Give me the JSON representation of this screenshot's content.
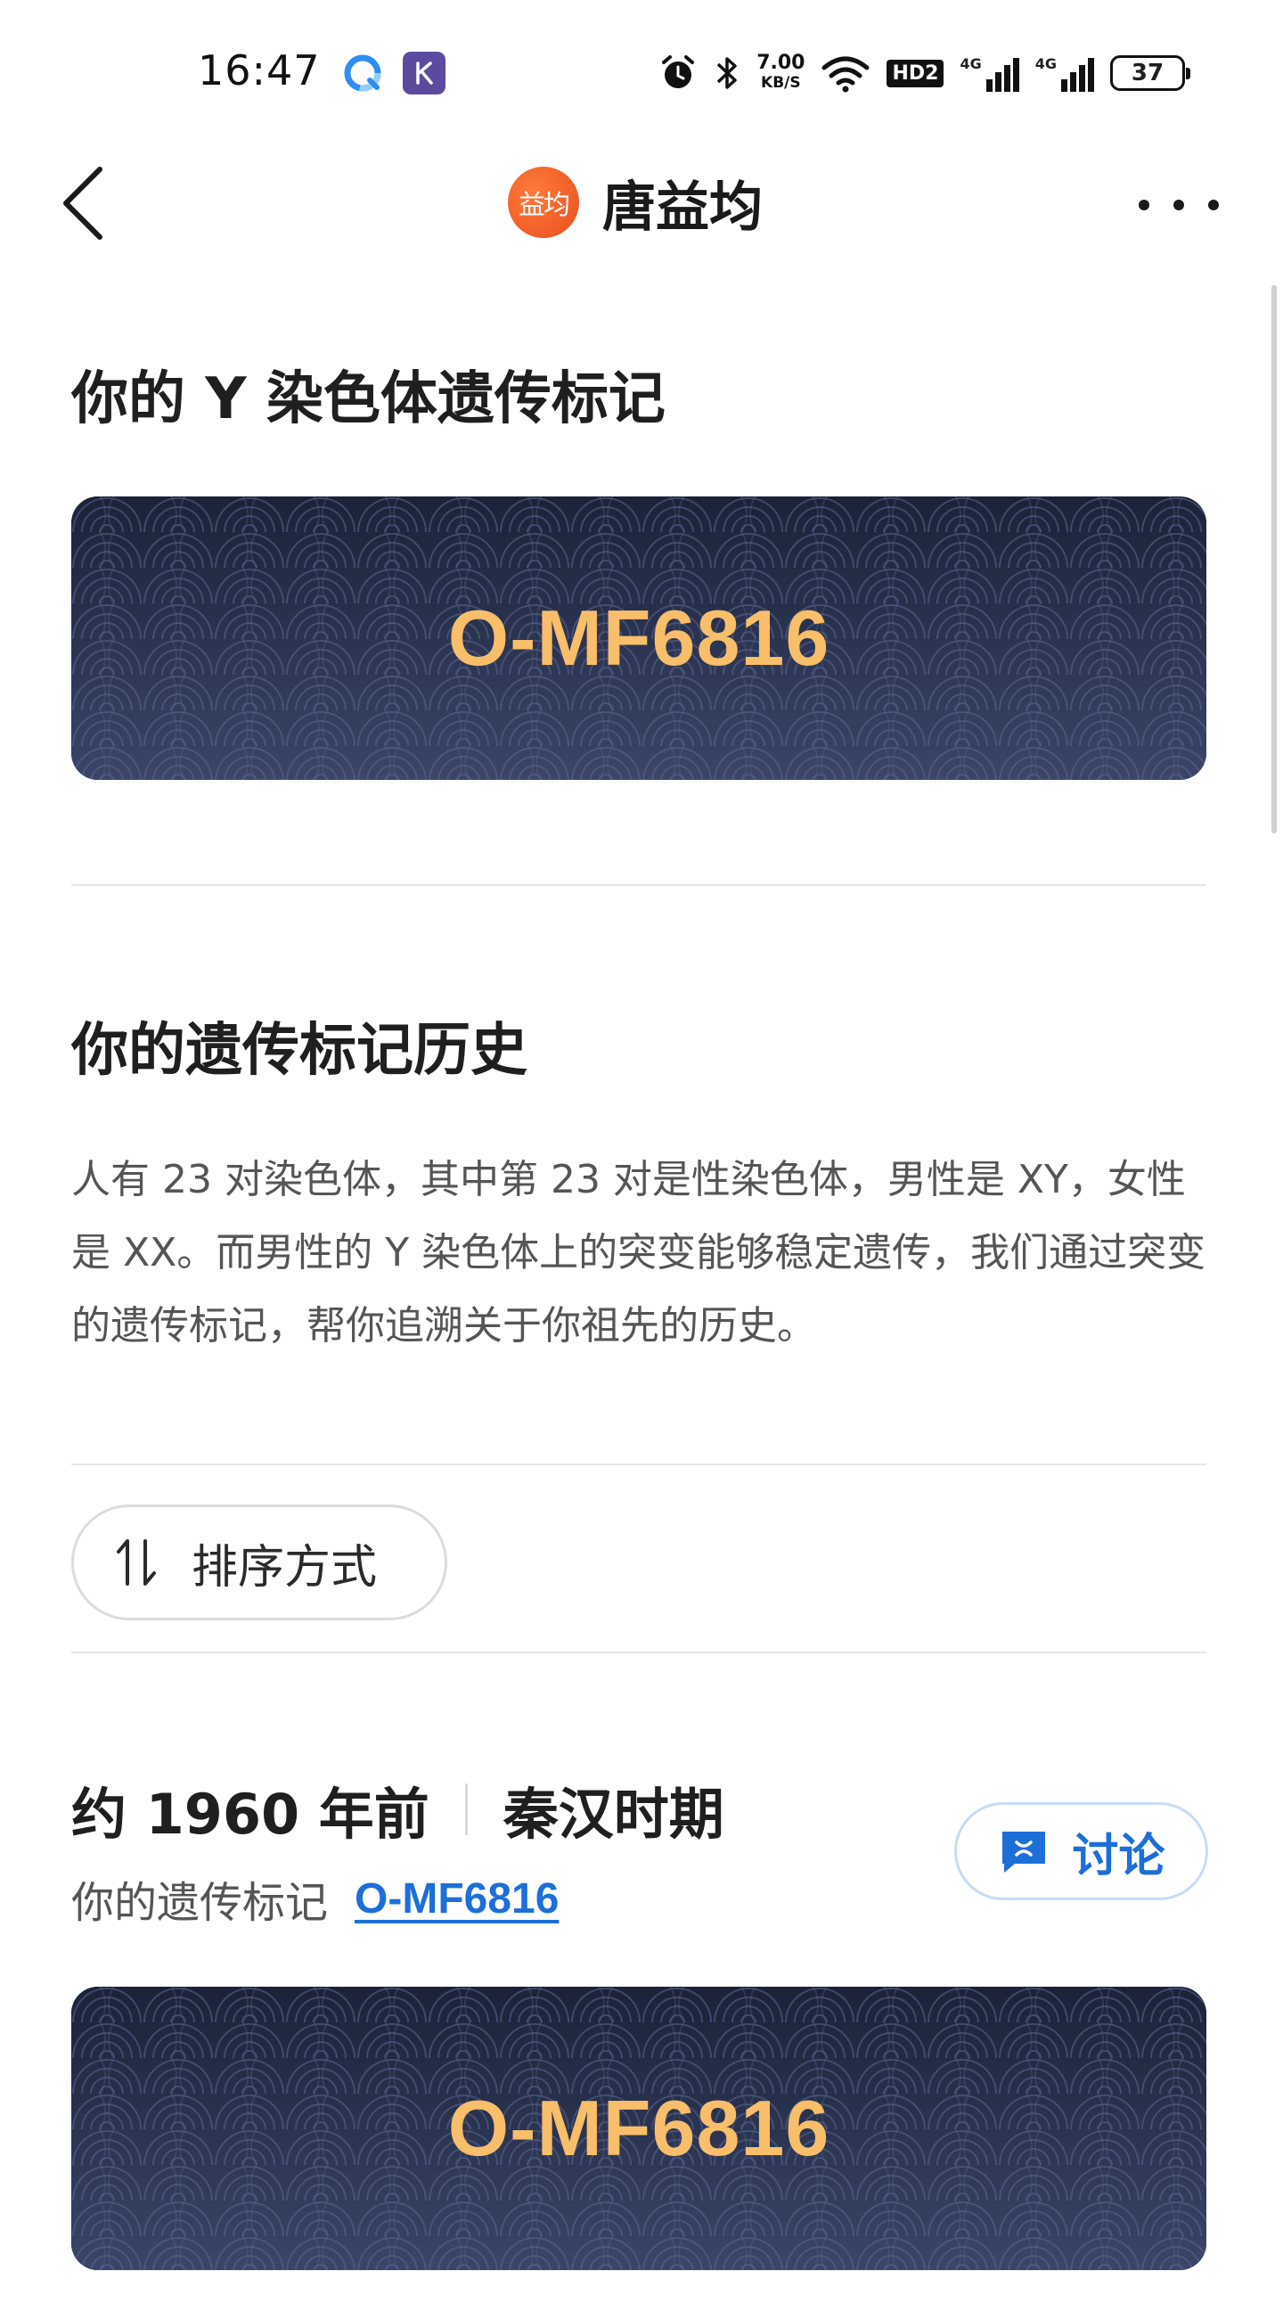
{
  "status_bar": {
    "time": "16:47",
    "net_speed_value": "7.00",
    "net_speed_unit": "KB/S",
    "hd_label": "HD2",
    "sim1_label": "4G",
    "sim2_label": "4G",
    "battery": "37"
  },
  "nav": {
    "avatar_text": "益均",
    "title": "唐益均"
  },
  "y_marker_section": {
    "heading": "你的 Y 染色体遗传标记",
    "marker_code": "O-MF6816"
  },
  "history_section": {
    "heading": "你的遗传标记历史",
    "description": "人有 23 对染色体，其中第 23 对是性染色体，男性是 XY，女性是 XX。而男性的 Y 染色体上的突变能够稳定遗传，我们通过突变的遗传标记，帮你追溯关于你祖先的历史。",
    "sort_label": "排序方式"
  },
  "era_entry": {
    "time_ago": "约 1960 年前",
    "period": "秦汉时期",
    "marker_prefix": "你的遗传标记",
    "marker_link": "O-MF6816",
    "discuss_label": "讨论",
    "card_code": "O-MF6816"
  },
  "colors": {
    "card_bg_dark": "#1b2238",
    "card_bg_light": "#3a4568",
    "code_gold": "#f8be6a",
    "link_blue": "#1d6fd8",
    "avatar_orange": "#e8501e"
  }
}
